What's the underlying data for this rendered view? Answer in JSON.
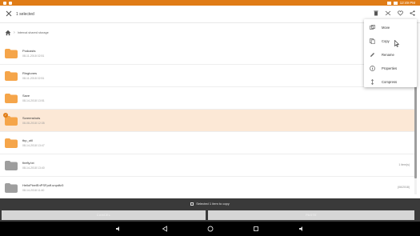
{
  "status_bar": {
    "clock": "12:49 PM"
  },
  "toolbar": {
    "selection_title": "1 selected"
  },
  "breadcrumb": {
    "path": "Internal shared storage"
  },
  "items": [
    {
      "name": "Podcasts",
      "date": "08-11-2018 02:51",
      "size": "",
      "type": "folder",
      "selected": false
    },
    {
      "name": "Ringtones",
      "date": "08-11-2018 02:51",
      "size": "",
      "type": "folder",
      "selected": false
    },
    {
      "name": "Save",
      "date": "08-14-2018 13:51",
      "size": "",
      "type": "folder",
      "selected": false
    },
    {
      "name": "Screenshots",
      "date": "08-08-2018 12:35",
      "size": "",
      "type": "folder",
      "selected": true
    },
    {
      "name": "tbp_util",
      "date": "08-14-2018 13:47",
      "size": "",
      "type": "folder",
      "selected": false
    },
    {
      "name": "firefly.txt",
      "date": "08-14-2018 13:40",
      "size": "1 item(s)",
      "type": "folder-gray",
      "selected": false
    },
    {
      "name": "HelloPixelEnPSFpdf.unpdfz3",
      "date": "08-14-2018 11:40",
      "size": "(06/2018)",
      "type": "folder-gray",
      "selected": false
    }
  ],
  "copy_bar": {
    "text": "Selected 1 item to copy"
  },
  "actions": {
    "cancel_label": "CANCEL",
    "paste_label": "PASTE"
  },
  "menu": {
    "items": [
      {
        "label": "Move",
        "icon": "move-icon"
      },
      {
        "label": "Copy",
        "icon": "copy-icon"
      },
      {
        "label": "Rename",
        "icon": "rename-icon"
      },
      {
        "label": "Properties",
        "icon": "info-icon"
      },
      {
        "label": "Compress",
        "icon": "compress-icon"
      }
    ]
  },
  "colors": {
    "accent": "#e07c16",
    "folder": "#f5a54a",
    "folder_gray": "#9e9e9e",
    "selected_row": "#fce8d6"
  }
}
